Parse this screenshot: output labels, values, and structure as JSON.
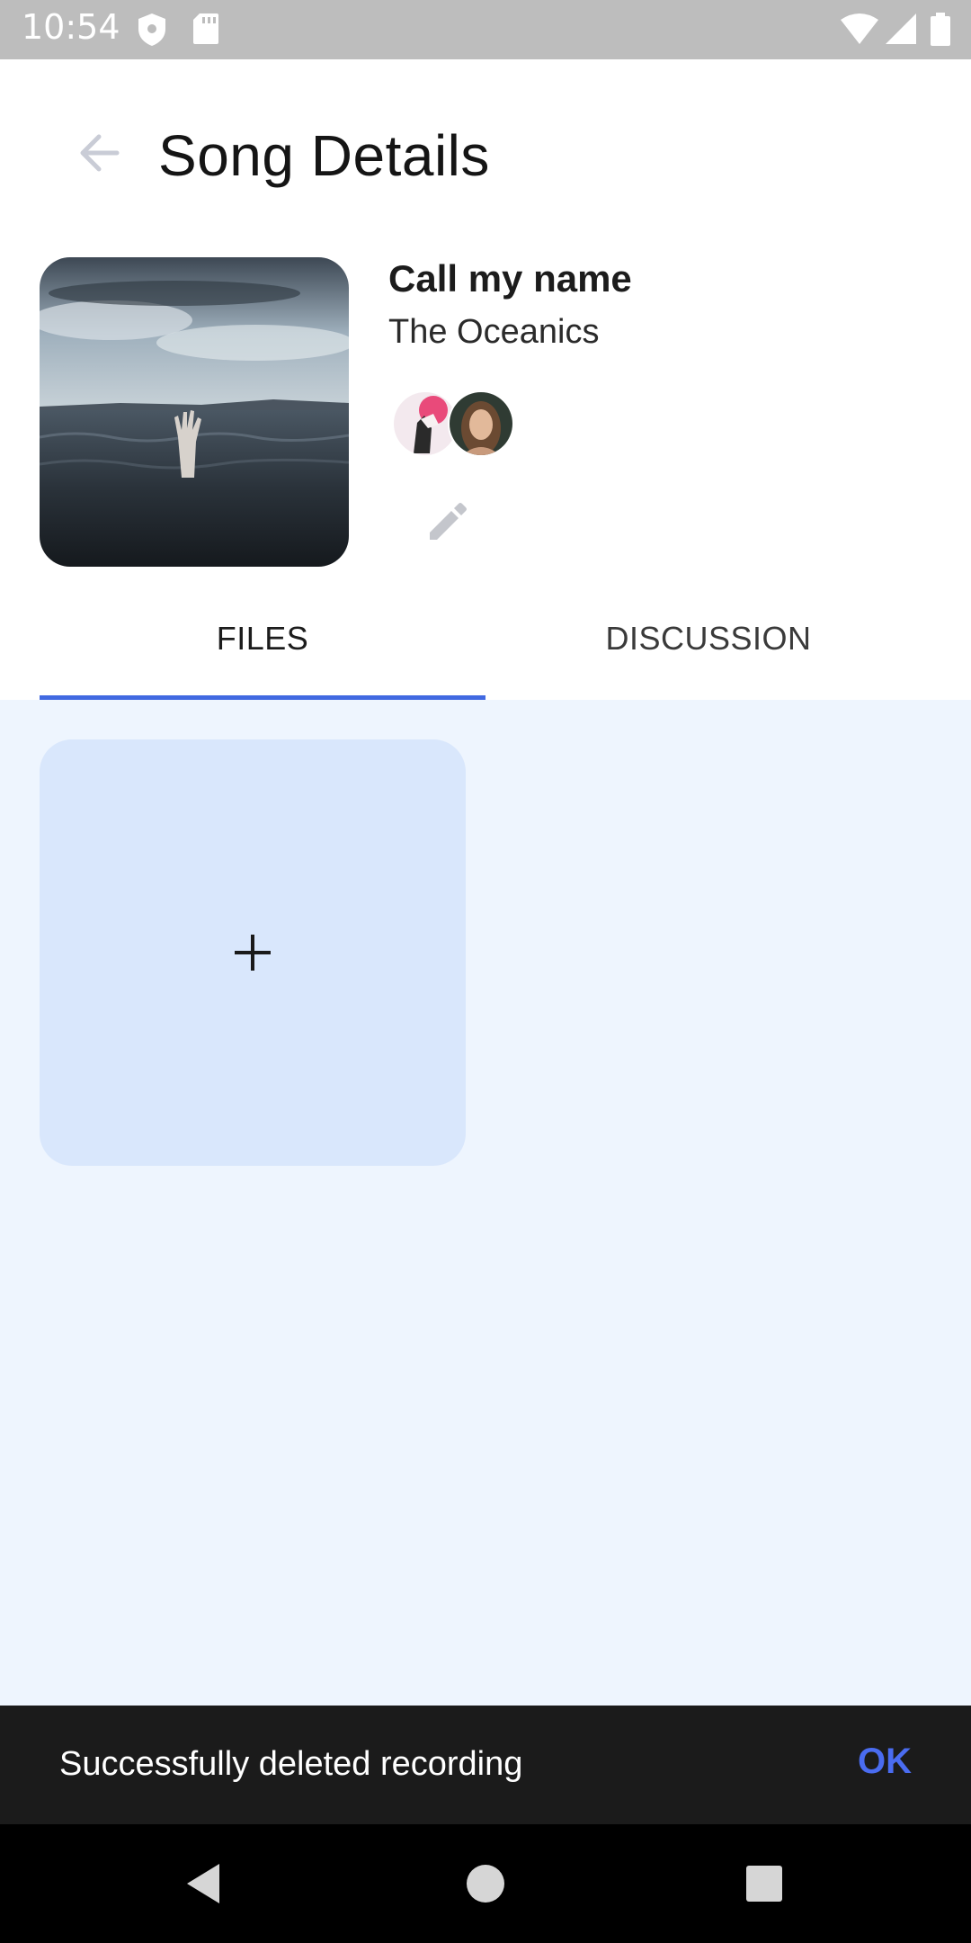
{
  "status_bar": {
    "time": "10:54",
    "icons": [
      "shield-icon",
      "sd-card-icon",
      "wifi-icon",
      "signal-icon",
      "battery-icon"
    ]
  },
  "app_bar": {
    "back_icon": "arrow-back-icon",
    "title": "Song Details"
  },
  "song": {
    "title": "Call my name",
    "artist": "The Oceanics",
    "cover_image": "hand-reaching-out-of-sea",
    "collaborators": [
      "collaborator-avatar-1",
      "collaborator-avatar-2"
    ],
    "edit_icon": "pencil-icon"
  },
  "tabs": [
    {
      "label": "FILES",
      "selected": true
    },
    {
      "label": "DISCUSSION",
      "selected": false
    }
  ],
  "files": {
    "add_icon": "plus-icon"
  },
  "snackbar": {
    "message": "Successfully deleted recording",
    "action": "OK"
  },
  "nav_bar": {
    "icons": [
      "nav-back-icon",
      "nav-home-icon",
      "nav-recents-icon"
    ]
  },
  "colors": {
    "accent": "#4169e1",
    "content_bg": "#eef5fe",
    "add_card_bg": "#d9e7fc",
    "snackbar_bg": "#1b1b1b",
    "snackbar_action": "#4a6cf0"
  }
}
